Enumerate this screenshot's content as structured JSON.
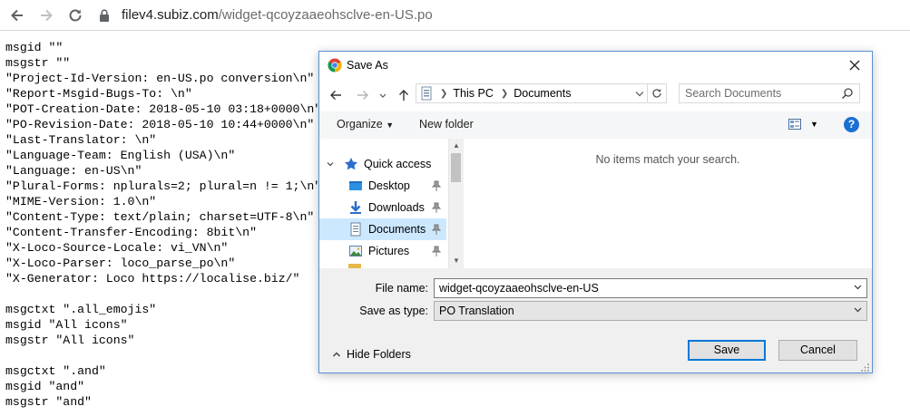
{
  "browser": {
    "url_host": "filev4.subiz.com",
    "url_path": "/widget-qcoyzaaeohsclve-en-US.po"
  },
  "po_lines": [
    "msgid \"\"",
    "msgstr \"\"",
    "\"Project-Id-Version: en-US.po conversion\\n\"",
    "\"Report-Msgid-Bugs-To: \\n\"",
    "\"POT-Creation-Date: 2018-05-10 03:18+0000\\n\"",
    "\"PO-Revision-Date: 2018-05-10 10:44+0000\\n\"",
    "\"Last-Translator: \\n\"",
    "\"Language-Team: English (USA)\\n\"",
    "\"Language: en-US\\n\"",
    "\"Plural-Forms: nplurals=2; plural=n != 1;\\n\"",
    "\"MIME-Version: 1.0\\n\"",
    "\"Content-Type: text/plain; charset=UTF-8\\n\"",
    "\"Content-Transfer-Encoding: 8bit\\n\"",
    "\"X-Loco-Source-Locale: vi_VN\\n\"",
    "\"X-Loco-Parser: loco_parse_po\\n\"",
    "\"X-Generator: Loco https://localise.biz/\"",
    "",
    "msgctxt \".all_emojis\"",
    "msgid \"All icons\"",
    "msgstr \"All icons\"",
    "",
    "msgctxt \".and\"",
    "msgid \"and\"",
    "msgstr \"and\""
  ],
  "dialog": {
    "title": "Save As",
    "breadcrumb": [
      "This PC",
      "Documents"
    ],
    "search_placeholder": "Search Documents",
    "toolbar": {
      "organize": "Organize",
      "new_folder": "New folder"
    },
    "nav_items": [
      {
        "label": "Quick access",
        "icon": "star-icon"
      },
      {
        "label": "Desktop",
        "icon": "desktop-folder-icon",
        "pinned": true
      },
      {
        "label": "Downloads",
        "icon": "download-arrow-icon",
        "pinned": true
      },
      {
        "label": "Documents",
        "icon": "documents-icon",
        "pinned": true,
        "selected": true
      },
      {
        "label": "Pictures",
        "icon": "pictures-icon",
        "pinned": true
      }
    ],
    "empty_message": "No items match your search.",
    "file_name_label": "File name:",
    "file_name_value": "widget-qcoyzaaeohsclve-en-US",
    "save_type_label": "Save as type:",
    "save_type_value": "PO Translation",
    "hide_folders": "Hide Folders",
    "save_button": "Save",
    "cancel_button": "Cancel"
  },
  "colors": {
    "dialog_border": "#5b8fd6",
    "selection": "#cce8ff",
    "help_blue": "#1c6fd1",
    "primary_button_border": "#0078d7"
  }
}
